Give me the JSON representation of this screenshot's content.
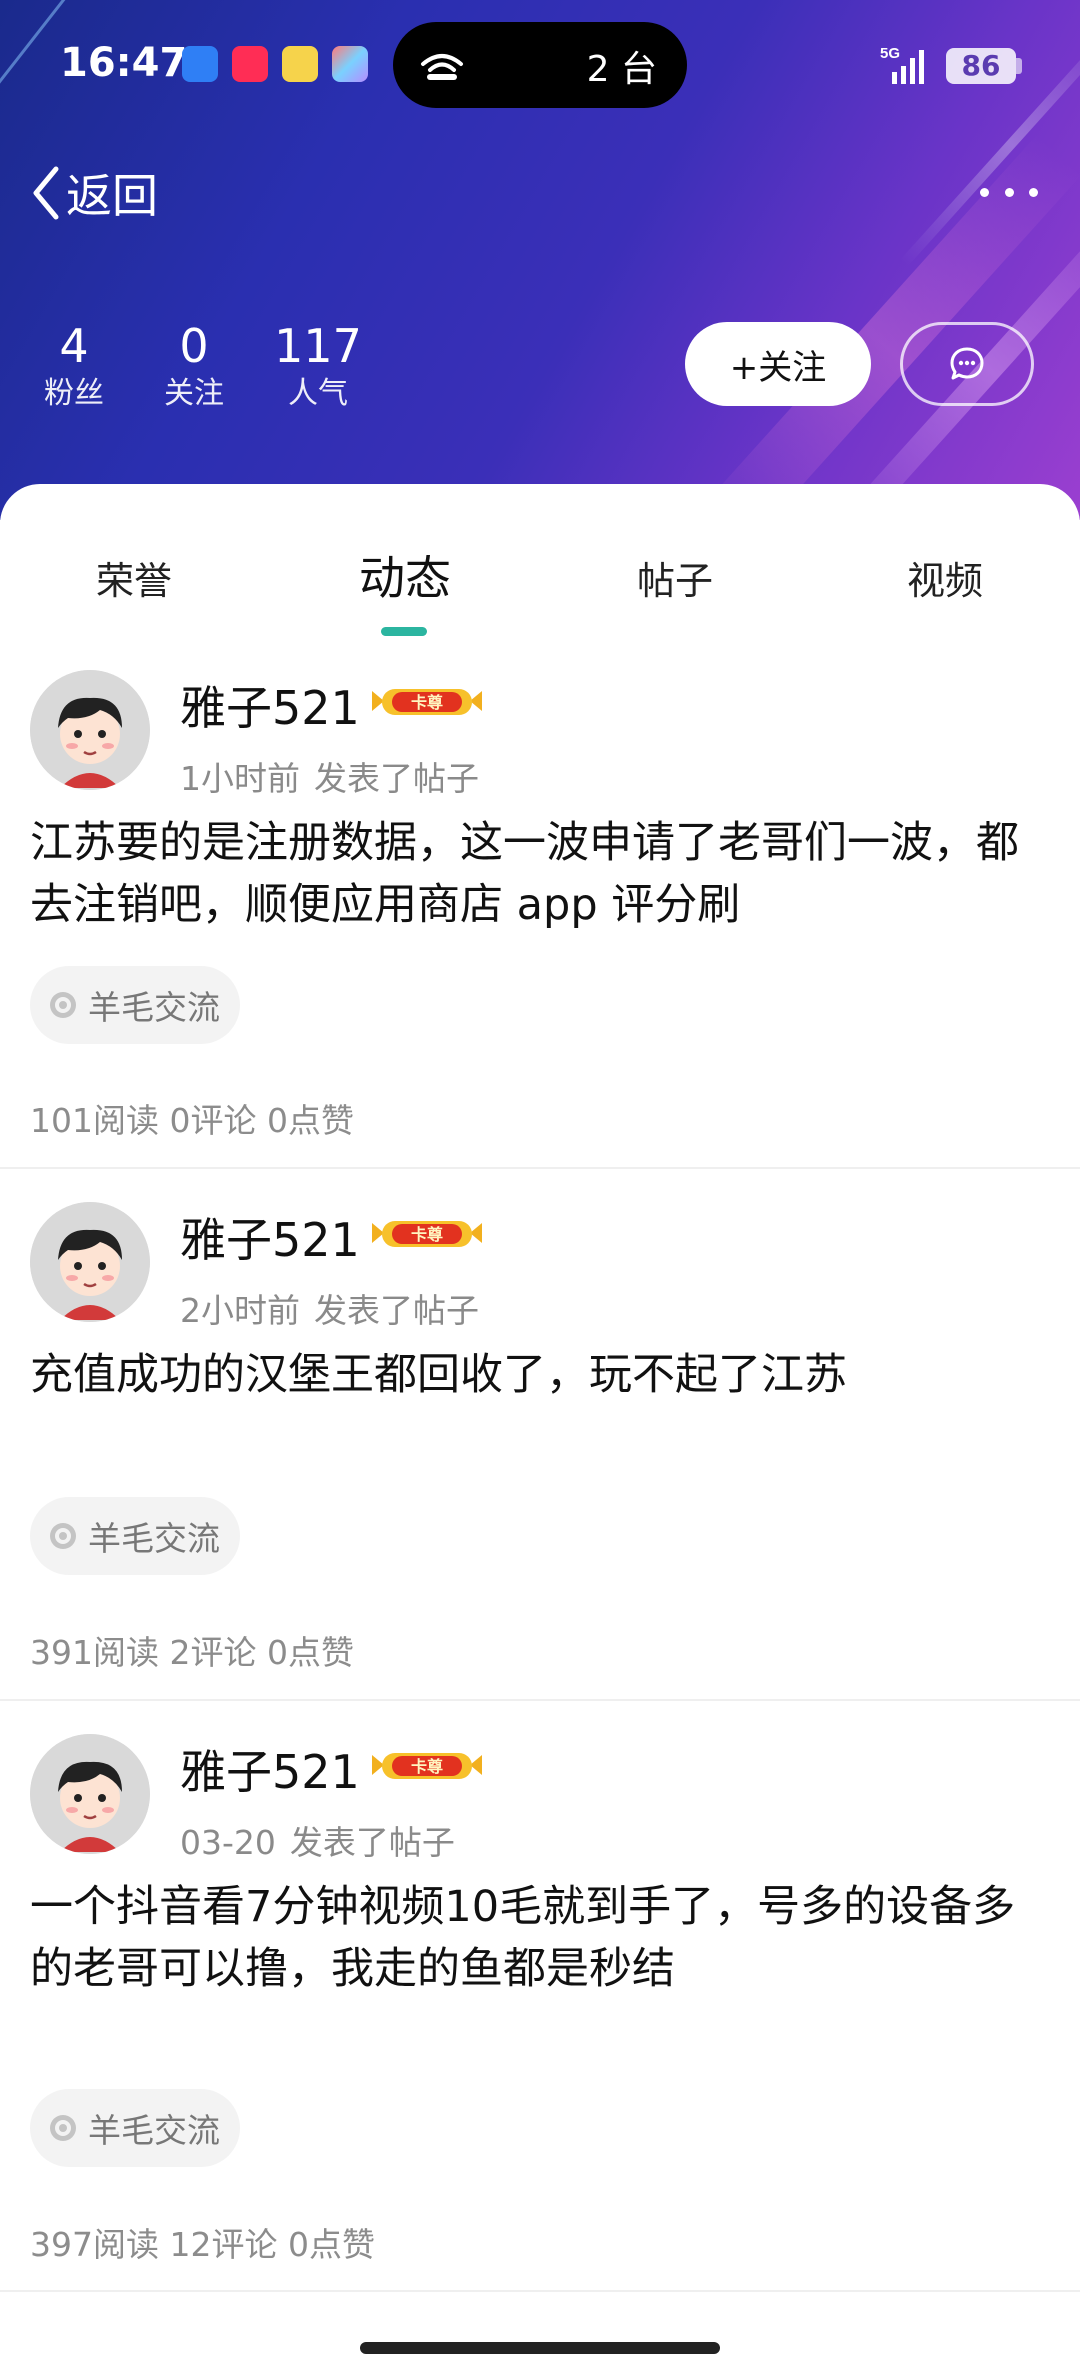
{
  "status_bar": {
    "time": "16:47",
    "island_text": "2 台",
    "network": "5G",
    "battery": "86"
  },
  "header": {
    "back_label": "返回",
    "stats": [
      {
        "value": "4",
        "label": "粉丝"
      },
      {
        "value": "0",
        "label": "关注"
      },
      {
        "value": "117",
        "label": "人气"
      }
    ],
    "follow_label": "+关注"
  },
  "tabs": [
    {
      "label": "荣誉",
      "active": false
    },
    {
      "label": "动态",
      "active": true
    },
    {
      "label": "帖子",
      "active": false
    },
    {
      "label": "视频",
      "active": false
    }
  ],
  "posts": [
    {
      "username": "雅子521",
      "badge": "卡尊",
      "time": "1小时前",
      "action": "发表了帖子",
      "text": "江苏要的是注册数据，这一波申请了老哥们一波，都去注销吧，顺便应用商店 app 评分刷",
      "tag": "羊毛交流",
      "stats": "101阅读 0评论 0点赞"
    },
    {
      "username": "雅子521",
      "badge": "卡尊",
      "time": "2小时前",
      "action": "发表了帖子",
      "text": "充值成功的汉堡王都回收了，玩不起了江苏",
      "tag": "羊毛交流",
      "stats": "391阅读 2评论 0点赞"
    },
    {
      "username": "雅子521",
      "badge": "卡尊",
      "time": "03-20",
      "action": "发表了帖子",
      "text": "一个抖音看7分钟视频10毛就到手了，号多的设备多的老哥可以撸，我走的鱼都是秒结",
      "tag": "羊毛交流",
      "stats": "397阅读 12评论 0点赞"
    }
  ],
  "colors": {
    "accent": "#2bb5a0",
    "header_start": "#1a2a8c",
    "header_end": "#9b3fd0"
  }
}
